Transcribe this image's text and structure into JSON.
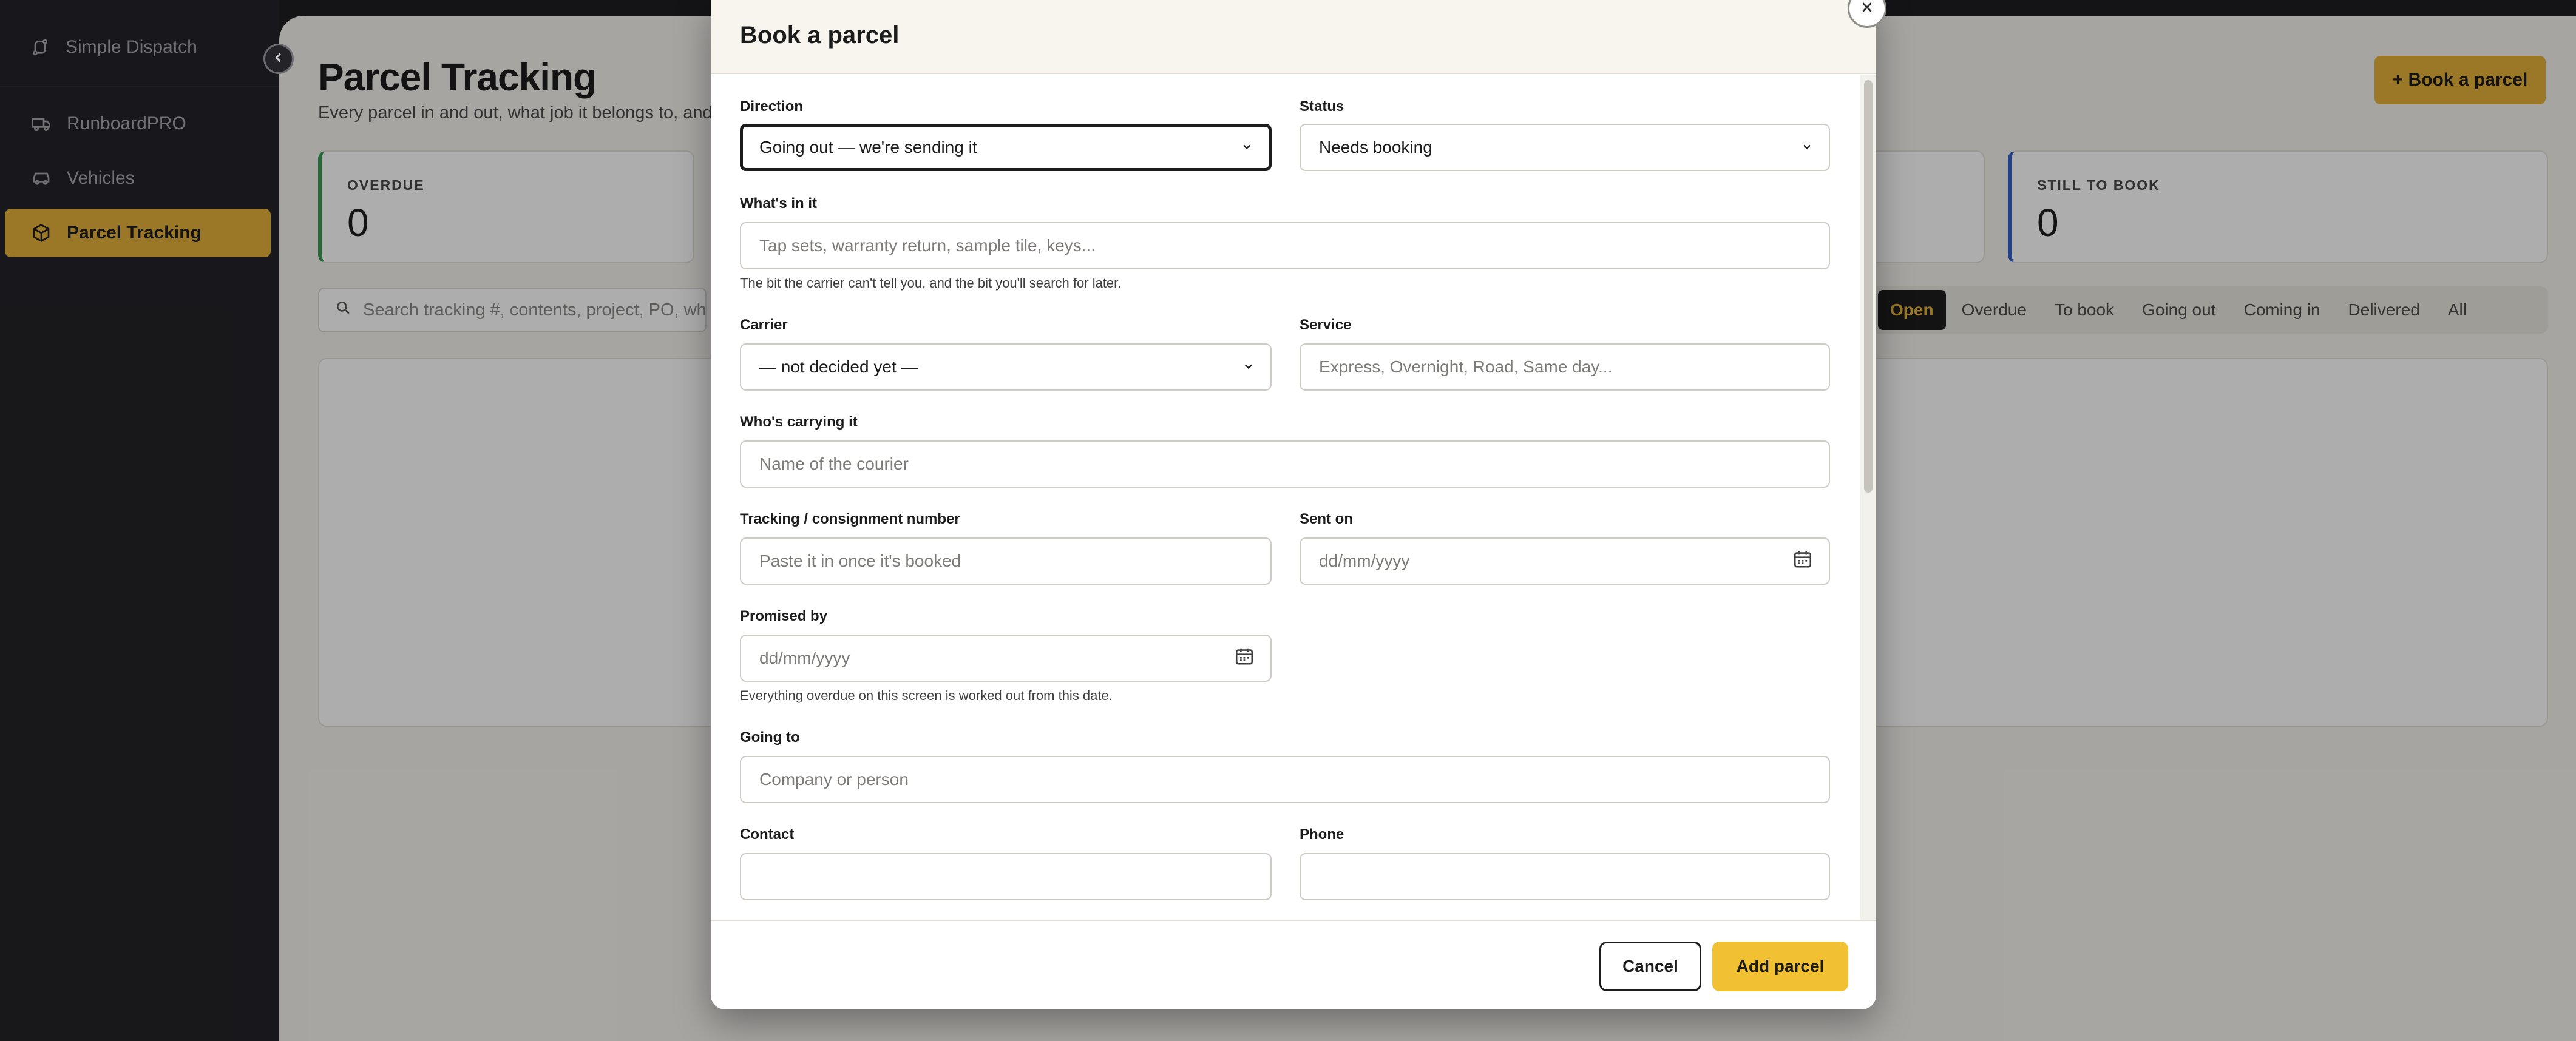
{
  "sidebar": {
    "brand": "Simple Dispatch",
    "items": [
      {
        "label": "RunboardPRO",
        "icon": "truck-icon"
      },
      {
        "label": "Vehicles",
        "icon": "car-icon"
      },
      {
        "label": "Parcel Tracking",
        "icon": "package-icon",
        "active": true
      }
    ]
  },
  "page": {
    "title": "Parcel Tracking",
    "subtitle": "Every parcel in and out, what job it belongs to, and wh",
    "cta": "+ Book a parcel",
    "stats": [
      {
        "label": "OVERDUE",
        "value": "0"
      },
      {
        "label": "STILL TO BOOK",
        "value": "0"
      }
    ],
    "search_placeholder": "Search tracking #, contents, project, PO, wh",
    "filters": [
      "Open",
      "Overdue",
      "To book",
      "Going out",
      "Coming in",
      "Delivered",
      "All"
    ],
    "active_filter": "Open"
  },
  "modal": {
    "title": "Book a parcel",
    "fields": {
      "direction": {
        "label": "Direction",
        "value": "Going out — we're sending it"
      },
      "status": {
        "label": "Status",
        "value": "Needs booking"
      },
      "contents": {
        "label": "What's in it",
        "placeholder": "Tap sets, warranty return, sample tile, keys...",
        "hint": "The bit the carrier can't tell you, and the bit you'll search for later."
      },
      "carrier": {
        "label": "Carrier",
        "value": "— not decided yet —"
      },
      "service": {
        "label": "Service",
        "placeholder": "Express, Overnight, Road, Same day..."
      },
      "courier": {
        "label": "Who's carrying it",
        "placeholder": "Name of the courier"
      },
      "tracking": {
        "label": "Tracking / consignment number",
        "placeholder": "Paste it in once it's booked"
      },
      "sent_on": {
        "label": "Sent on",
        "placeholder": "dd/mm/yyyy"
      },
      "promised_by": {
        "label": "Promised by",
        "placeholder": "dd/mm/yyyy",
        "hint": "Everything overdue on this screen is worked out from this date."
      },
      "going_to": {
        "label": "Going to",
        "placeholder": "Company or person"
      },
      "contact": {
        "label": "Contact",
        "placeholder": ""
      },
      "phone": {
        "label": "Phone",
        "placeholder": ""
      }
    },
    "cancel_label": "Cancel",
    "submit_label": "Add parcel"
  },
  "colors": {
    "accent": "#e3b23c",
    "sidebar_bg": "#242328",
    "overdue_border": "#3a9a55",
    "tobook_border": "#3461c9"
  }
}
